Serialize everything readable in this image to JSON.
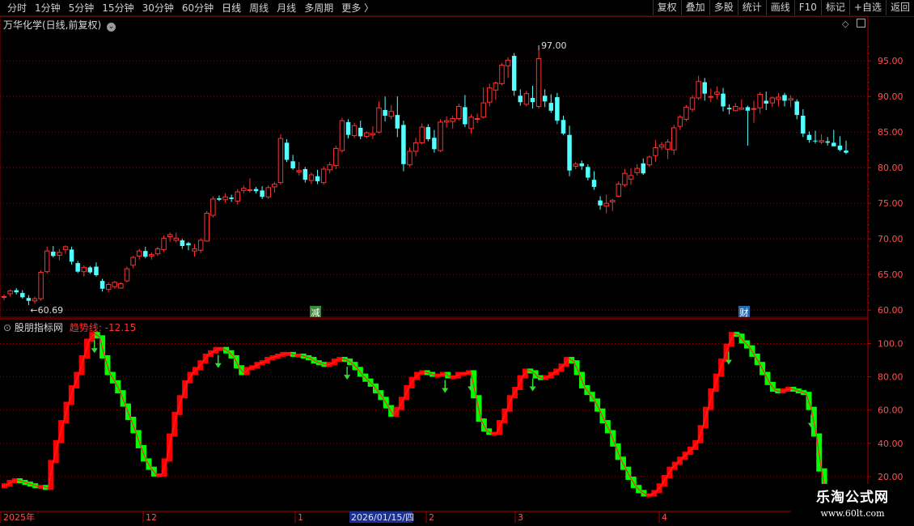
{
  "toolbar": {
    "periods": [
      "分时",
      "1分钟",
      "5分钟",
      "15分钟",
      "30分钟",
      "60分钟",
      "日线",
      "周线",
      "月线",
      "多周期",
      "更多 〉"
    ],
    "active_period": "日线",
    "right_buttons": [
      "复权",
      "叠加",
      "多股",
      "统计",
      "画线",
      "F10",
      "标记",
      "+自选",
      "返回"
    ]
  },
  "main_panel": {
    "title": "万华化学(日线,前复权)",
    "y_ticks": [
      "95.00",
      "90.00",
      "85.00",
      "80.00",
      "75.00",
      "70.00",
      "65.00",
      "60.00"
    ],
    "high_label": "97.00",
    "low_label": "60.69",
    "event_marks": [
      "减",
      "财"
    ]
  },
  "sub_panel": {
    "title": "股朋指标网",
    "indicator_label": "趋势线:",
    "indicator_value": "-12.15",
    "y_ticks": [
      "100.0",
      "80.00",
      "60.00",
      "40.00",
      "20.00"
    ]
  },
  "date_axis": {
    "labels": [
      "2025年",
      "12",
      "1",
      "2",
      "3",
      "4"
    ],
    "cursor_date": "2026/01/15/四"
  },
  "watermark": {
    "brand": "乐淘公式网",
    "url": "www.60lt.com"
  },
  "colors": {
    "up": "#ff3232",
    "down": "#54ffff",
    "ind_up": "#ff0000",
    "ind_down": "#00ff00",
    "grid": "#8b0000",
    "axis_text": "#ff5050",
    "background": "#000000"
  },
  "candles": [
    [
      61.8,
      62.2,
      61.4,
      61.9
    ],
    [
      62.3,
      62.9,
      61.9,
      62.7
    ],
    [
      62.8,
      63.1,
      62.2,
      62.5
    ],
    [
      62.4,
      62.8,
      61.6,
      61.8
    ],
    [
      61.7,
      62.1,
      60.7,
      61.3
    ],
    [
      61.3,
      61.9,
      60.9,
      61.6
    ],
    [
      61.6,
      65.6,
      61.3,
      65.3
    ],
    [
      65.4,
      68.9,
      65.1,
      68.3
    ],
    [
      68.2,
      69.0,
      67.4,
      67.6
    ],
    [
      67.7,
      68.6,
      67.0,
      68.1
    ],
    [
      68.5,
      69.1,
      67.9,
      68.9
    ],
    [
      68.5,
      68.9,
      66.4,
      66.8
    ],
    [
      66.6,
      66.9,
      65.2,
      65.4
    ],
    [
      65.4,
      66.3,
      64.7,
      66.0
    ],
    [
      66.0,
      66.2,
      65.1,
      65.3
    ],
    [
      66.1,
      66.7,
      64.7,
      64.9
    ],
    [
      64.1,
      64.4,
      62.6,
      63.0
    ],
    [
      62.9,
      63.9,
      62.5,
      63.6
    ],
    [
      63.3,
      64.1,
      63.0,
      63.9
    ],
    [
      63.1,
      63.9,
      63.0,
      63.7
    ],
    [
      64.1,
      66.1,
      63.9,
      65.8
    ],
    [
      66.3,
      67.6,
      65.9,
      67.4
    ],
    [
      67.6,
      68.6,
      67.1,
      68.3
    ],
    [
      68.3,
      68.9,
      67.3,
      67.5
    ],
    [
      67.6,
      68.1,
      67.1,
      67.8
    ],
    [
      67.9,
      68.9,
      67.6,
      68.6
    ],
    [
      68.5,
      70.5,
      68.2,
      70.1
    ],
    [
      70.3,
      70.9,
      69.6,
      70.6
    ],
    [
      69.8,
      70.9,
      69.5,
      70.1
    ],
    [
      69.8,
      70.0,
      68.6,
      69.0
    ],
    [
      69.4,
      69.6,
      68.4,
      69.1
    ],
    [
      68.3,
      69.3,
      67.5,
      68.6
    ],
    [
      68.4,
      70.1,
      68.0,
      69.8
    ],
    [
      69.7,
      73.9,
      69.6,
      73.6
    ],
    [
      73.3,
      76.0,
      73.0,
      75.6
    ],
    [
      75.7,
      76.1,
      75.3,
      75.5
    ],
    [
      75.5,
      76.4,
      75.1,
      75.9
    ],
    [
      75.8,
      76.2,
      75.2,
      75.6
    ],
    [
      75.3,
      77.0,
      74.8,
      76.6
    ],
    [
      76.8,
      77.5,
      76.4,
      77.1
    ],
    [
      76.9,
      78.5,
      76.5,
      76.9
    ],
    [
      77.0,
      77.3,
      76.4,
      76.7
    ],
    [
      76.8,
      77.4,
      75.6,
      75.9
    ],
    [
      75.9,
      77.5,
      75.6,
      77.2
    ],
    [
      77.3,
      78.0,
      76.5,
      77.7
    ],
    [
      77.9,
      84.7,
      77.6,
      84.1
    ],
    [
      83.5,
      84.0,
      80.8,
      81.1
    ],
    [
      80.9,
      81.8,
      79.7,
      79.9
    ],
    [
      79.4,
      80.8,
      78.9,
      79.6
    ],
    [
      79.8,
      80.1,
      77.9,
      78.3
    ],
    [
      78.2,
      79.3,
      77.7,
      79.0
    ],
    [
      78.8,
      79.7,
      77.7,
      78.1
    ],
    [
      77.9,
      80.2,
      77.6,
      79.8
    ],
    [
      79.7,
      80.8,
      79.2,
      80.4
    ],
    [
      80.3,
      83.1,
      79.8,
      82.7
    ],
    [
      82.4,
      87.0,
      82.1,
      86.6
    ],
    [
      86.4,
      86.8,
      84.1,
      84.6
    ],
    [
      84.5,
      86.3,
      84.2,
      85.9
    ],
    [
      85.6,
      86.6,
      84.0,
      84.4
    ],
    [
      84.4,
      85.1,
      84.1,
      84.9
    ],
    [
      84.6,
      85.8,
      84.0,
      84.8
    ],
    [
      85.0,
      89.3,
      84.8,
      88.4
    ],
    [
      88.1,
      90.0,
      86.5,
      87.3
    ],
    [
      87.2,
      88.8,
      86.8,
      87.9
    ],
    [
      87.4,
      90.0,
      84.3,
      85.5
    ],
    [
      86.0,
      86.6,
      79.5,
      80.5
    ],
    [
      80.4,
      82.8,
      80.1,
      82.3
    ],
    [
      82.3,
      84.2,
      81.6,
      83.5
    ],
    [
      83.5,
      86.2,
      83.3,
      85.7
    ],
    [
      85.7,
      86.1,
      83.7,
      84.0
    ],
    [
      84.2,
      85.3,
      82.1,
      82.6
    ],
    [
      82.4,
      86.8,
      82.2,
      86.4
    ],
    [
      86.4,
      87.2,
      85.6,
      86.6
    ],
    [
      86.5,
      87.3,
      85.5,
      86.9
    ],
    [
      86.9,
      89.0,
      86.6,
      88.6
    ],
    [
      88.5,
      90.2,
      85.7,
      86.1
    ],
    [
      85.5,
      87.5,
      84.8,
      87.1
    ],
    [
      86.8,
      87.6,
      86.3,
      86.9
    ],
    [
      87.1,
      91.3,
      86.9,
      89.1
    ],
    [
      89.2,
      91.8,
      88.6,
      91.2
    ],
    [
      90.9,
      92.1,
      89.5,
      91.9
    ],
    [
      91.8,
      94.7,
      91.6,
      94.4
    ],
    [
      94.3,
      95.5,
      92.6,
      95.1
    ],
    [
      95.7,
      96.1,
      90.1,
      90.8
    ],
    [
      90.1,
      91.0,
      88.7,
      89.2
    ],
    [
      88.9,
      90.8,
      88.6,
      90.4
    ],
    [
      89.8,
      91.5,
      88.3,
      89.2
    ],
    [
      88.6,
      96.5,
      88.3,
      95.3
    ],
    [
      90.1,
      91.0,
      88.5,
      89.3
    ],
    [
      89.1,
      90.3,
      87.7,
      88.0
    ],
    [
      89.9,
      90.5,
      86.1,
      86.6
    ],
    [
      86.7,
      87.3,
      84.6,
      84.8
    ],
    [
      84.6,
      85.9,
      78.8,
      79.6
    ],
    [
      80.2,
      80.8,
      79.8,
      80.5
    ],
    [
      80.6,
      81.0,
      79.7,
      80.2
    ],
    [
      80.1,
      80.5,
      78.2,
      78.6
    ],
    [
      78.3,
      79.5,
      76.9,
      77.3
    ],
    [
      75.4,
      76.0,
      74.1,
      74.7
    ],
    [
      74.6,
      76.2,
      73.6,
      75.0
    ],
    [
      75.2,
      75.6,
      73.9,
      75.4
    ],
    [
      76.0,
      78.1,
      75.8,
      77.7
    ],
    [
      77.6,
      79.8,
      77.3,
      79.2
    ],
    [
      78.4,
      79.9,
      77.6,
      78.9
    ],
    [
      79.3,
      80.5,
      78.9,
      79.9
    ],
    [
      80.6,
      81.3,
      79.0,
      79.2
    ],
    [
      80.4,
      81.7,
      80.1,
      81.5
    ],
    [
      81.7,
      83.9,
      80.8,
      82.8
    ],
    [
      82.9,
      83.6,
      82.5,
      83.2
    ],
    [
      82.6,
      84.0,
      81.2,
      83.6
    ],
    [
      82.5,
      86.0,
      81.8,
      85.6
    ],
    [
      85.8,
      87.4,
      85.3,
      87.1
    ],
    [
      86.8,
      88.8,
      86.5,
      88.5
    ],
    [
      88.2,
      90.2,
      87.8,
      89.8
    ],
    [
      89.8,
      92.9,
      89.5,
      92.1
    ],
    [
      92.0,
      92.6,
      89.4,
      90.4
    ],
    [
      89.9,
      91.1,
      89.2,
      90.0
    ],
    [
      90.3,
      91.4,
      89.6,
      90.6
    ],
    [
      90.4,
      91.2,
      87.9,
      88.6
    ],
    [
      88.4,
      88.9,
      87.5,
      88.2
    ],
    [
      88.0,
      89.1,
      87.9,
      88.6
    ],
    [
      88.2,
      89.6,
      88.1,
      88.4
    ],
    [
      88.5,
      88.7,
      83.1,
      88.0
    ],
    [
      88.2,
      89.4,
      86.3,
      88.3
    ],
    [
      88.4,
      90.6,
      87.6,
      90.3
    ],
    [
      89.4,
      90.7,
      88.1,
      89.0
    ],
    [
      89.1,
      90.0,
      88.5,
      89.8
    ],
    [
      89.6,
      90.5,
      88.6,
      89.9
    ],
    [
      90.2,
      90.5,
      88.6,
      89.4
    ],
    [
      89.5,
      90.2,
      88.5,
      89.7
    ],
    [
      89.3,
      89.6,
      86.8,
      87.4
    ],
    [
      87.3,
      88.2,
      84.3,
      84.8
    ],
    [
      84.6,
      85.1,
      83.5,
      83.9
    ],
    [
      83.8,
      85.2,
      83.4,
      83.7
    ],
    [
      83.6,
      84.7,
      83.3,
      83.8
    ],
    [
      83.7,
      84.3,
      83.1,
      83.5
    ],
    [
      83.5,
      85.3,
      83.2,
      83.0
    ],
    [
      83.1,
      84.4,
      82.3,
      82.5
    ],
    [
      82.4,
      83.8,
      81.9,
      82.1
    ]
  ],
  "indicator": [
    14,
    15,
    17,
    18,
    17,
    16,
    15,
    14,
    14,
    13,
    29,
    41,
    53,
    64,
    74,
    82,
    92,
    102,
    106,
    104,
    92,
    82,
    77,
    71,
    63,
    55,
    47,
    38,
    30,
    25,
    21,
    21,
    30,
    45,
    58,
    68,
    77,
    82,
    85,
    89,
    93,
    95,
    97,
    97,
    95,
    92,
    86,
    82,
    85,
    86,
    88,
    89,
    91,
    92,
    93,
    94,
    94,
    93,
    93,
    92,
    91,
    89,
    88,
    87,
    88,
    90,
    91,
    90,
    88,
    85,
    81,
    78,
    75,
    71,
    67,
    62,
    57,
    61,
    67,
    74,
    79,
    82,
    83,
    82,
    81,
    81,
    82,
    80,
    80,
    82,
    82,
    83,
    68,
    54,
    48,
    46,
    46,
    53,
    60,
    68,
    73,
    80,
    84,
    83,
    80,
    79,
    80,
    82,
    84,
    87,
    91,
    89,
    82,
    74,
    70,
    66,
    60,
    53,
    47,
    39,
    31,
    25,
    19,
    14,
    11,
    9,
    9,
    11,
    15,
    20,
    25,
    28,
    31,
    34,
    37,
    41,
    50,
    61,
    72,
    81,
    90,
    99,
    106,
    105,
    101,
    98,
    93,
    88,
    82,
    76,
    72,
    71,
    72,
    73,
    72,
    71,
    70,
    61,
    45,
    24,
    8
  ],
  "tail_annotations": "sub-panel arrows rendered",
  "chart_data": [
    {
      "type": "candlestick",
      "title": "万华化学(日线,前复权)",
      "ylim": [
        59,
        99
      ],
      "y_ticks": [
        95,
        90,
        85,
        80,
        75,
        70,
        65,
        60
      ],
      "annotations": [
        "97.00",
        "60.69"
      ]
    },
    {
      "type": "line",
      "title": "股朋指标网",
      "series": [
        {
          "name": "趋势线",
          "last_value": -12.15
        }
      ],
      "ylim": [
        0,
        110
      ],
      "y_ticks": [
        100,
        80,
        60,
        40,
        20
      ]
    }
  ]
}
